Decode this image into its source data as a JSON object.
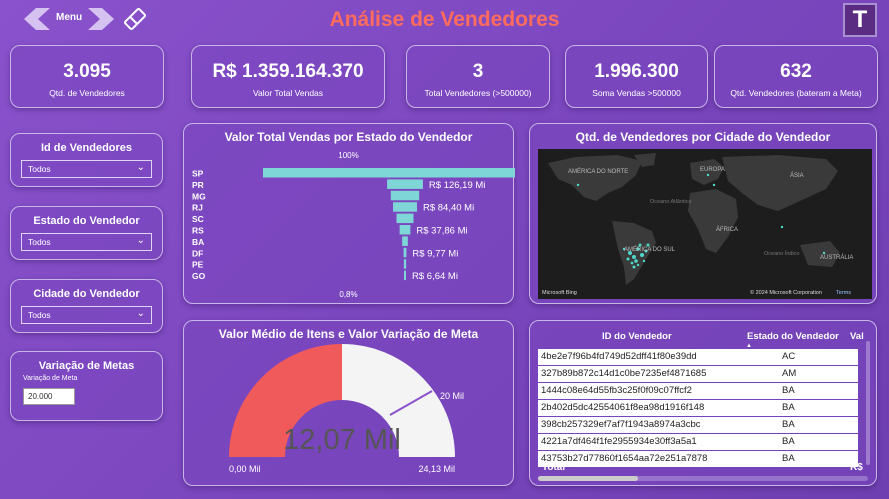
{
  "header": {
    "menu_label": "Menu",
    "title": "Análise de Vendedores",
    "logo_letter": "T"
  },
  "kpis": [
    {
      "value": "3.095",
      "label": "Qtd. de Vendedores"
    },
    {
      "value": "R$ 1.359.164.370",
      "label": "Valor Total Vendas"
    },
    {
      "value": "3",
      "label": "Total Vendedores (>500000)"
    },
    {
      "value": "1.996.300",
      "label": "Soma Vendas >500000"
    },
    {
      "value": "632",
      "label": "Qtd. Vendedores (bateram a Meta)"
    }
  ],
  "filters": [
    {
      "title": "Id de Vendedores",
      "value": "Todos"
    },
    {
      "title": "Estado do Vendedor",
      "value": "Todos"
    },
    {
      "title": "Cidade do Vendedor",
      "value": "Todos"
    }
  ],
  "meta_filter": {
    "title": "Variação de Metas",
    "label": "Variação de Meta",
    "value": "20.000"
  },
  "funnel": {
    "title": "Valor Total Vendas por Estado do Vendedor",
    "top_label": "100%",
    "bottom_label": "0,8%"
  },
  "map": {
    "title": "Qtd. de Vendedores por Cidade do Vendedor",
    "labels": {
      "na": "AMÉRICA DO NORTE",
      "eu": "EUROPA",
      "as": "ÁSIA",
      "oa": "Oceano Atlântico",
      "af": "ÁFRICA",
      "oi": "Oceano Índico",
      "sa": "AMÉRICA DO SUL",
      "au": "AUSTRÁLIA"
    },
    "bing": "Microsoft Bing",
    "credit": "© 2024 Microsoft Corporation",
    "terms": "Terms"
  },
  "gauge": {
    "title": "Valor Médio de Itens e Valor Variação de Meta",
    "value_label": "12,07 Mil",
    "min_label": "0,00 Mil",
    "max_label": "24,13 Mil",
    "target_label": "20 Mil"
  },
  "table": {
    "col_id": "ID do Vendedor",
    "col_state": "Estado do Vendedor",
    "col_value": "Val",
    "rows": [
      {
        "id": "4be2e7f96b4fd749d52dff41f80e39dd",
        "state": "AC"
      },
      {
        "id": "327b89b872c14d1c0be7235ef4871685",
        "state": "AM"
      },
      {
        "id": "1444c08e64d55fb3c25f0f09c07ffcf2",
        "state": "BA"
      },
      {
        "id": "2b402d5dc42554061f8ea98d1916f148",
        "state": "BA"
      },
      {
        "id": "398cb257329ef7af7f1943a8974a3cbc",
        "state": "BA"
      },
      {
        "id": "4221a7df464f1fe2955934e30ff3a5a1",
        "state": "BA"
      },
      {
        "id": "43753b27d77860f1654aa72e251a7878",
        "state": "BA"
      }
    ],
    "total_label": "Total",
    "total_value": "R$"
  },
  "colors": {
    "accent": "#ff6b5c",
    "funnel": "#7fd6d6",
    "gauge_fill": "#f05a5a",
    "gauge_rest": "#f4f4f4",
    "gauge_target": "#8a52cc"
  },
  "chart_data": {
    "type": "bar",
    "title": "Valor Total Vendas por Estado do Vendedor",
    "categories": [
      "SP",
      "PR",
      "MG",
      "RJ",
      "SC",
      "RS",
      "BA",
      "DF",
      "PE",
      "GO"
    ],
    "values": [
      1000,
      126.19,
      100,
      84.4,
      60,
      37.86,
      20,
      9.77,
      8,
      6.64
    ],
    "data_labels": [
      "",
      "R$ 126,19 Mi",
      "",
      "R$ 84,40 Mi",
      "",
      "R$ 37,86 Mi",
      "",
      "R$ 9,77 Mi",
      "",
      "R$ 6,64 Mi"
    ],
    "orientation": "horizontal-funnel"
  }
}
